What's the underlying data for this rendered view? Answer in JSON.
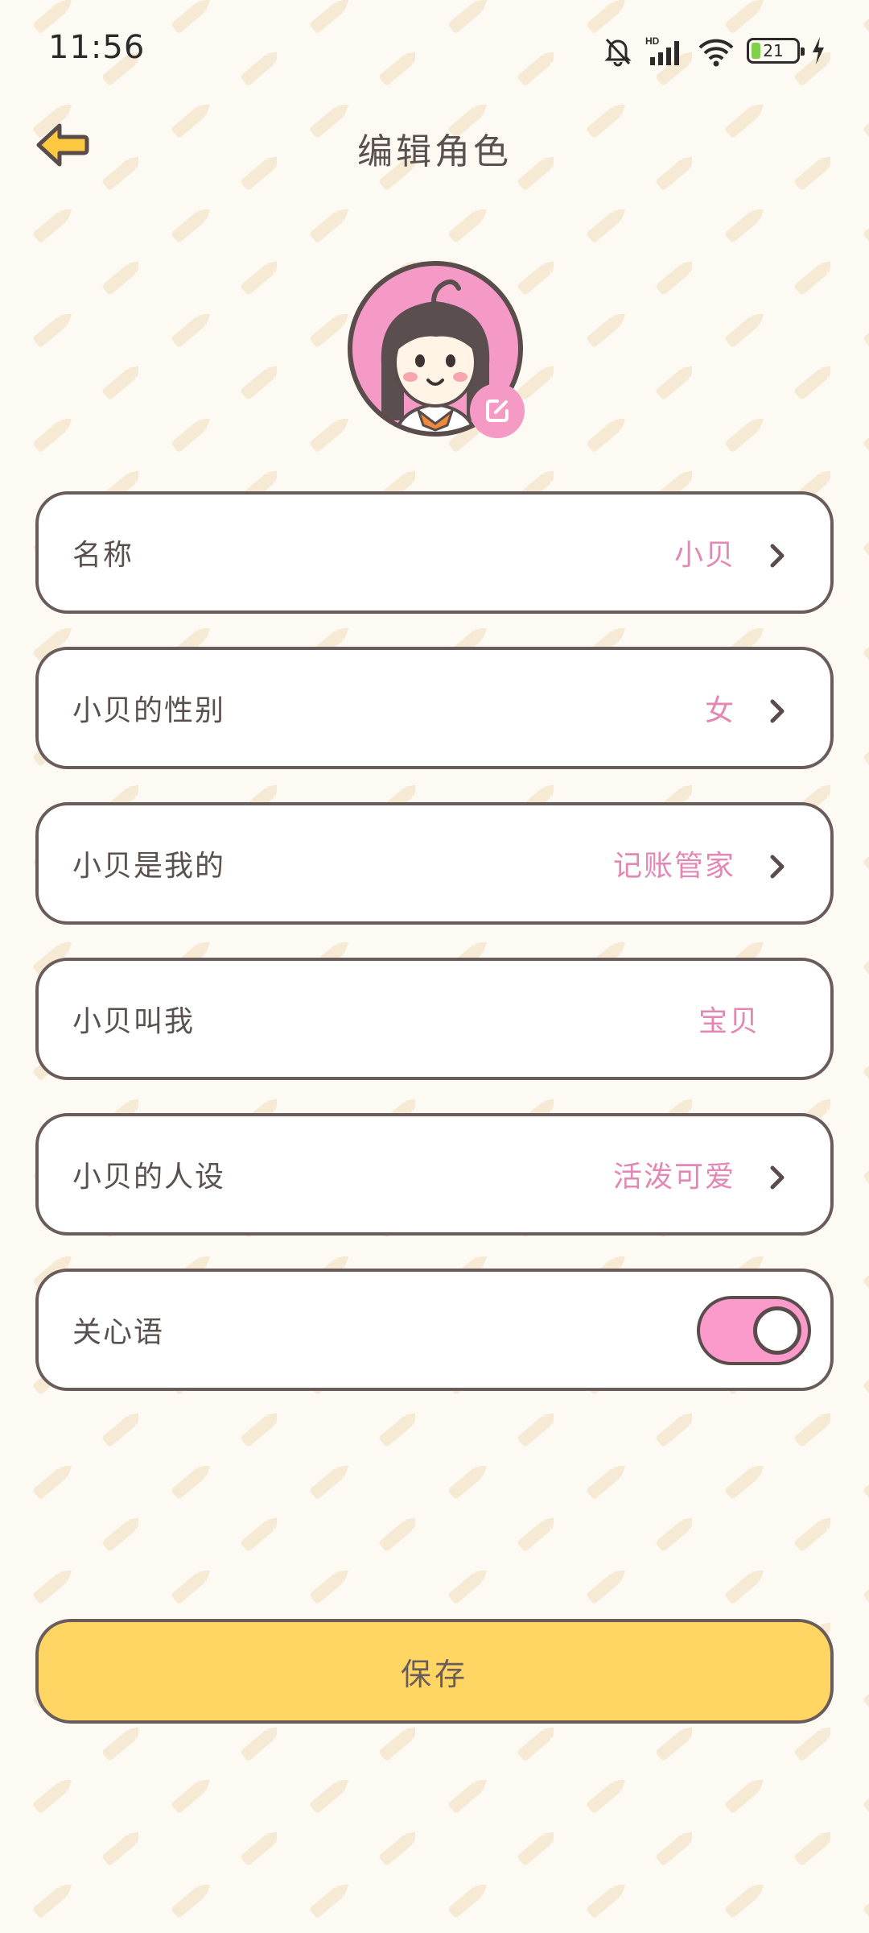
{
  "status_bar": {
    "time": "11:56",
    "network_label": "HD",
    "battery_level": "21",
    "battery_fraction": 0.21,
    "icons": [
      "mute-bell-icon",
      "signal-icon",
      "wifi-icon",
      "battery-icon",
      "charging-icon"
    ]
  },
  "header": {
    "title": "编辑角色",
    "back_icon": "arrow-left-icon"
  },
  "avatar": {
    "edit_icon": "edit-icon"
  },
  "settings": {
    "rows": [
      {
        "label": "名称",
        "value": "小贝",
        "has_chevron": true
      },
      {
        "label": "小贝的性别",
        "value": "女",
        "has_chevron": true
      },
      {
        "label": "小贝是我的",
        "value": "记账管家",
        "has_chevron": true
      },
      {
        "label": "小贝叫我",
        "value": "宝贝",
        "has_chevron": false
      },
      {
        "label": "小贝的人设",
        "value": "活泼可爱",
        "has_chevron": true
      }
    ],
    "care_words": {
      "label": "关心语",
      "enabled": true
    }
  },
  "save_button": {
    "label": "保存"
  },
  "colors": {
    "background": "#fdf9f3",
    "accent_pink": "#e387b5",
    "toggle_pink": "#fa9bcb",
    "save_yellow": "#ffd663",
    "border_brown": "#6b5c5c"
  }
}
